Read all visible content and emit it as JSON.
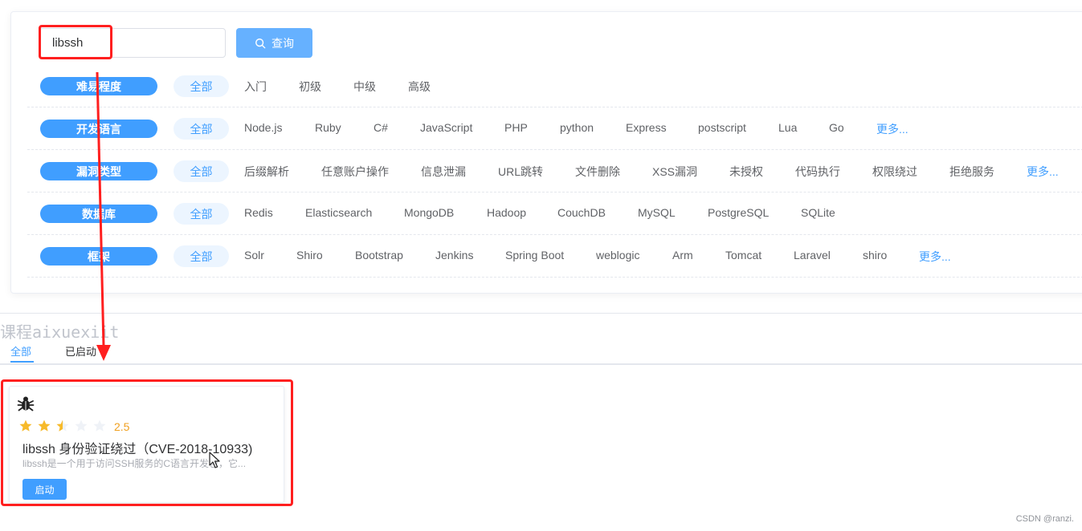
{
  "search": {
    "value": "libssh",
    "button_label": "查询"
  },
  "filters": [
    {
      "label": "难易程度",
      "all": "全部",
      "options": [
        "入门",
        "初级",
        "中级",
        "高级"
      ],
      "more": ""
    },
    {
      "label": "开发语言",
      "all": "全部",
      "options": [
        "Node.js",
        "Ruby",
        "C#",
        "JavaScript",
        "PHP",
        "python",
        "Express",
        "postscript",
        "Lua",
        "Go"
      ],
      "more": "更多..."
    },
    {
      "label": "漏洞类型",
      "all": "全部",
      "options": [
        "后缀解析",
        "任意账户操作",
        "信息泄漏",
        "URL跳转",
        "文件删除",
        "XSS漏洞",
        "未授权",
        "代码执行",
        "权限绕过",
        "拒绝服务"
      ],
      "more": "更多..."
    },
    {
      "label": "数据库",
      "all": "全部",
      "options": [
        "Redis",
        "Elasticsearch",
        "MongoDB",
        "Hadoop",
        "CouchDB",
        "MySQL",
        "PostgreSQL",
        "SQLite"
      ],
      "more": ""
    },
    {
      "label": "框架",
      "all": "全部",
      "options": [
        "Solr",
        "Shiro",
        "Bootstrap",
        "Jenkins",
        "Spring Boot",
        "weblogic",
        "Arm",
        "Tomcat",
        "Laravel",
        "shiro"
      ],
      "more": "更多..."
    }
  ],
  "watermark": "课程aixuexiit",
  "tabs": {
    "all": "全部",
    "started": "已启动"
  },
  "card": {
    "icon": "bug-icon",
    "rating": 2.5,
    "rating_text": "2.5",
    "title": "libssh 身份验证绕过（CVE-2018-10933)",
    "description": "libssh是一个用于访问SSH服务的C语言开发包，它...",
    "start_label": "启动"
  },
  "credit": "CSDN @ranzi.",
  "colors": {
    "accent": "#409eff",
    "highlight": "#ff1f1f",
    "star": "#f7ba2a"
  }
}
